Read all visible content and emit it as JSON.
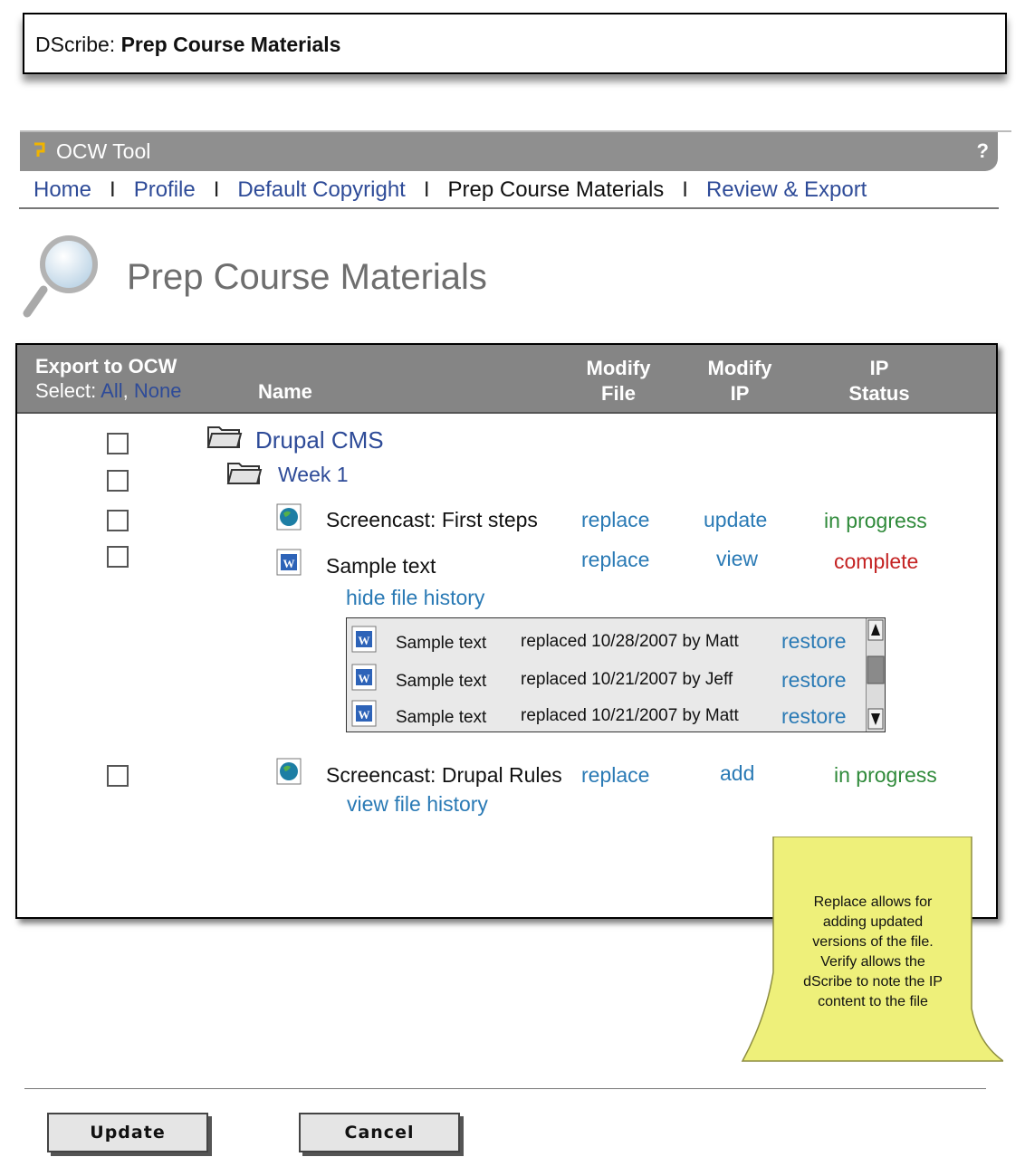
{
  "window": {
    "app": "DScribe:",
    "title": "Prep Course Materials"
  },
  "tool": {
    "name": "OCW Tool",
    "help": "?"
  },
  "nav": {
    "items": [
      "Home",
      "Profile",
      "Default Copyright",
      "Prep Course Materials",
      "Review & Export"
    ],
    "separator": "I",
    "current": "Prep Course Materials"
  },
  "page": {
    "title": "Prep Course Materials"
  },
  "table": {
    "headers": {
      "export": "Export to OCW",
      "select_label": "Select:",
      "select_all": "All",
      "select_comma": ",",
      "select_none": "None",
      "name": "Name",
      "modify_file_1": "Modify",
      "modify_file_2": "File",
      "modify_ip_1": "Modify",
      "modify_ip_2": "IP",
      "ip_status_1": "IP",
      "ip_status_2": "Status"
    },
    "folders": [
      {
        "name": "Drupal CMS"
      },
      {
        "name": "Week 1"
      }
    ],
    "files": [
      {
        "name": "Screencast: First steps",
        "type": "screencast",
        "modify_file": "replace",
        "modify_ip": "update",
        "ip_status": "in progress",
        "status_color": "#2f8a3a"
      },
      {
        "name": "Sample text",
        "type": "document",
        "modify_file": "replace",
        "modify_ip": "view",
        "ip_status": "complete",
        "status_color": "#c42222",
        "history_link": "hide file history"
      },
      {
        "name": "Screencast: Drupal Rules",
        "type": "screencast",
        "modify_file": "replace",
        "modify_ip": "add",
        "ip_status": "in progress",
        "status_color": "#2f8a3a",
        "history_link": "view file history"
      }
    ],
    "history": [
      {
        "name": "Sample text",
        "note": "replaced 10/28/2007 by Matt",
        "action": "restore"
      },
      {
        "name": "Sample text",
        "note": "replaced 10/21/2007 by Jeff",
        "action": "restore"
      },
      {
        "name": "Sample text",
        "note": "replaced 10/21/2007 by Matt",
        "action": "restore"
      }
    ]
  },
  "sticky_note": {
    "lines": [
      "Replace allows for",
      "adding updated",
      "versions of the file.",
      "Verify allows the",
      "dScribe to note the IP",
      "content to the file"
    ],
    "color": "#eef07a"
  },
  "buttons": {
    "update": "Update",
    "cancel": "Cancel"
  }
}
